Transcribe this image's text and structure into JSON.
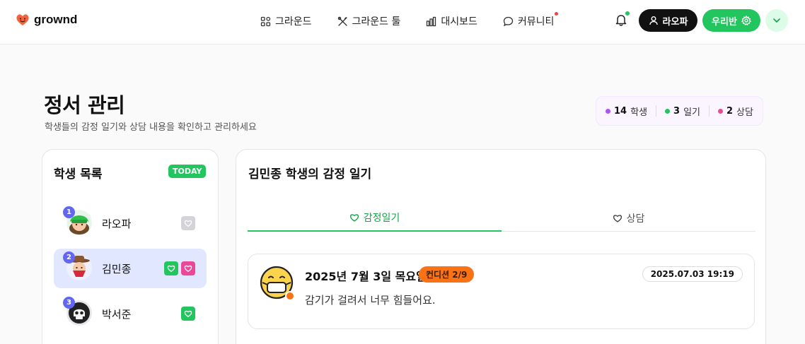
{
  "brand": {
    "name": "grownd"
  },
  "nav": {
    "items": [
      {
        "label": "그라운드",
        "icon": "grid-icon"
      },
      {
        "label": "그라운드 툴",
        "icon": "tools-icon"
      },
      {
        "label": "대시보드",
        "icon": "bar-chart-icon"
      },
      {
        "label": "커뮤니티",
        "icon": "chat-bubble-icon"
      }
    ],
    "user_label": "라오파",
    "class_label": "우리반"
  },
  "page": {
    "title": "정서 관리",
    "subtitle": "학생들의 감정 일기와 상담 내용을 확인하고 관리하세요"
  },
  "stats": [
    {
      "value": "14",
      "label": "학생",
      "color": "#a855f7"
    },
    {
      "value": "3",
      "label": "일기",
      "color": "#22c55e"
    },
    {
      "value": "2",
      "label": "상담",
      "color": "#ec4899"
    }
  ],
  "student_list": {
    "title": "학생 목록",
    "badge": "TODAY",
    "students": [
      {
        "rank": "1",
        "name": "라오파"
      },
      {
        "rank": "2",
        "name": "김민종"
      },
      {
        "rank": "3",
        "name": "박서준"
      }
    ]
  },
  "detail": {
    "title": "김민종 학생의 감정 일기",
    "tabs": [
      {
        "label": "감정일기"
      },
      {
        "label": "상담"
      }
    ],
    "entry": {
      "date": "2025년 7월 3일 목요일",
      "condition": "컨디션 2/9",
      "timestamp": "2025.07.03 19:19",
      "text": "감기가 걸려서 너무 힘들어요."
    }
  },
  "colors": {
    "accent": "#22c55e",
    "selected_row": "#e0e7ff",
    "rank_badge": "#6366f1",
    "condition": "#f97316",
    "pink": "#ec4899"
  }
}
